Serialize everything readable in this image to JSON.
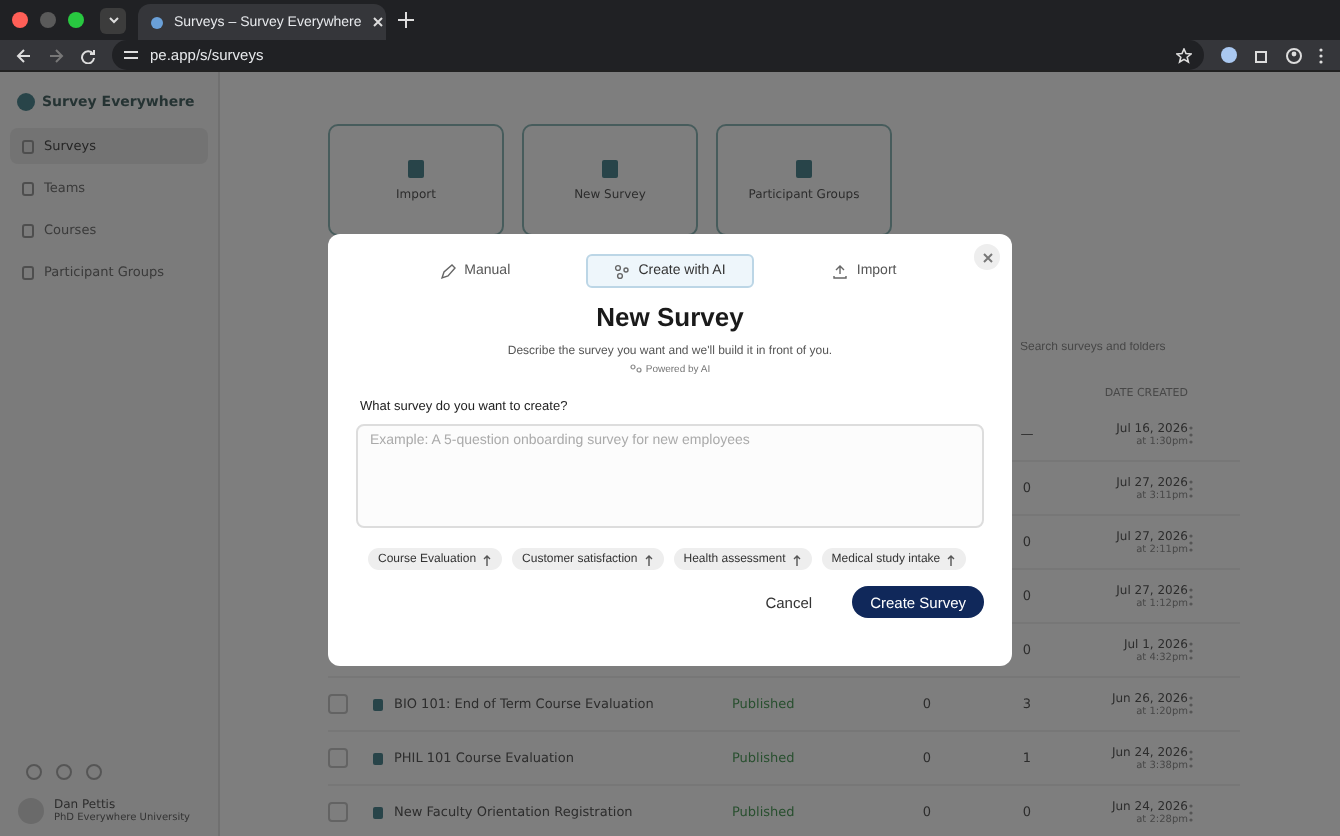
{
  "browser": {
    "tab_title": "Surveys – Survey Everywhere",
    "url": "pe.app/s/surveys"
  },
  "sidebar": {
    "logo": "Survey Everywhere",
    "items": [
      {
        "label": "Surveys",
        "selected": true
      },
      {
        "label": "Teams",
        "selected": false
      },
      {
        "label": "Courses",
        "selected": false
      },
      {
        "label": "Participant Groups",
        "selected": false
      }
    ],
    "user": {
      "name": "Dan Pettis",
      "subtitle": "PhD Everywhere University"
    }
  },
  "actions": [
    "Import",
    "New Survey",
    "Participant Groups"
  ],
  "search": {
    "placeholder": "Search surveys and folders"
  },
  "table": {
    "columns": [
      "DATE CREATED"
    ],
    "rows": [
      {
        "count": "—",
        "date": "Jul 16, 2026",
        "time": "at 1:30pm"
      },
      {
        "count": "0",
        "date": "Jul 27, 2026",
        "time": "at 3:11pm"
      },
      {
        "count": "0",
        "date": "Jul 27, 2026",
        "time": "at 2:11pm"
      },
      {
        "count": "0",
        "date": "Jul 27, 2026",
        "time": "at 1:12pm"
      },
      {
        "count": "0",
        "date": "Jul 1, 2026",
        "time": "at 4:32pm"
      },
      {
        "name": "BIO 101: End of Term Course Evaluation",
        "checked": false,
        "status": "Published",
        "responses": "0",
        "count": "3",
        "date": "Jun 26, 2026",
        "time": "at 1:20pm"
      },
      {
        "name": "PHIL 101 Course Evaluation",
        "checked": false,
        "status": "Published",
        "responses": "0",
        "count": "1",
        "date": "Jun 24, 2026",
        "time": "at 3:38pm"
      },
      {
        "name": "New Faculty Orientation Registration",
        "checked": false,
        "status": "Published",
        "responses": "0",
        "count": "0",
        "date": "Jun 24, 2026",
        "time": "at 2:28pm"
      }
    ]
  },
  "dialog": {
    "tabs": [
      {
        "label": "Manual",
        "kind": "pencil",
        "selected": false
      },
      {
        "label": "Create with AI",
        "kind": "sparkle",
        "selected": true
      },
      {
        "label": "Import",
        "kind": "upload",
        "selected": false
      }
    ],
    "title": "New Survey",
    "description": "Describe the survey you want and we'll build it in front of you.",
    "badge": "Powered by AI",
    "field_label": "What survey do you want to create?",
    "placeholder": "Example: A 5-question onboarding survey for new employees",
    "suggestions": [
      "Course Evaluation",
      "Customer satisfaction",
      "Health assessment",
      "Medical study intake"
    ],
    "buttons": [
      {
        "label": "Cancel",
        "kind": "secondary"
      },
      {
        "label": "Create Survey",
        "kind": "primary"
      }
    ]
  }
}
